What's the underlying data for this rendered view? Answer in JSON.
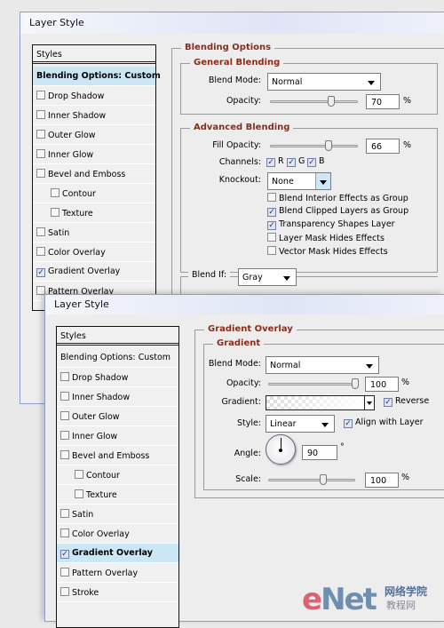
{
  "back": {
    "title": "Layer Style",
    "styles_header": "Styles",
    "styles": [
      {
        "label": "Blending Options: Custom",
        "selected": true,
        "nocheck": true
      },
      {
        "label": "Drop Shadow",
        "checked": false
      },
      {
        "label": "Inner Shadow",
        "checked": false
      },
      {
        "label": "Outer Glow",
        "checked": false
      },
      {
        "label": "Inner Glow",
        "checked": false
      },
      {
        "label": "Bevel and Emboss",
        "checked": false
      },
      {
        "label": "Contour",
        "checked": false,
        "indent": true
      },
      {
        "label": "Texture",
        "checked": false,
        "indent": true
      },
      {
        "label": "Satin",
        "checked": false
      },
      {
        "label": "Color Overlay",
        "checked": false
      },
      {
        "label": "Gradient Overlay",
        "checked": true
      },
      {
        "label": "Pattern Overlay",
        "checked": false
      }
    ],
    "section": "Blending Options",
    "general": {
      "title": "General Blending",
      "blend_mode_label": "Blend Mode:",
      "blend_mode": "Normal",
      "opacity_label": "Opacity:",
      "opacity": "70",
      "unit": "%"
    },
    "advanced": {
      "title": "Advanced Blending",
      "fill_label": "Fill Opacity:",
      "fill": "66",
      "unit": "%",
      "channels_label": "Channels:",
      "channels": [
        {
          "label": "R",
          "checked": true
        },
        {
          "label": "G",
          "checked": true
        },
        {
          "label": "B",
          "checked": true
        }
      ],
      "knockout_label": "Knockout:",
      "knockout": "None",
      "options": [
        {
          "label": "Blend Interior Effects as Group",
          "checked": false
        },
        {
          "label": "Blend Clipped Layers as Group",
          "checked": true
        },
        {
          "label": "Transparency Shapes Layer",
          "checked": true
        },
        {
          "label": "Layer Mask Hides Effects",
          "checked": false
        },
        {
          "label": "Vector Mask Hides Effects",
          "checked": false
        }
      ]
    },
    "blend_if_label": "Blend If:",
    "blend_if": "Gray"
  },
  "front": {
    "title": "Layer Style",
    "styles_header": "Styles",
    "styles": [
      {
        "label": "Blending Options: Custom",
        "nocheck": true
      },
      {
        "label": "Drop Shadow",
        "checked": false
      },
      {
        "label": "Inner Shadow",
        "checked": false
      },
      {
        "label": "Outer Glow",
        "checked": false
      },
      {
        "label": "Inner Glow",
        "checked": false
      },
      {
        "label": "Bevel and Emboss",
        "checked": false
      },
      {
        "label": "Contour",
        "checked": false,
        "indent": true
      },
      {
        "label": "Texture",
        "checked": false,
        "indent": true
      },
      {
        "label": "Satin",
        "checked": false
      },
      {
        "label": "Color Overlay",
        "checked": false
      },
      {
        "label": "Gradient Overlay",
        "checked": true,
        "selected": true
      },
      {
        "label": "Pattern Overlay",
        "checked": false
      },
      {
        "label": "Stroke",
        "checked": false
      }
    ],
    "section": "Gradient Overlay",
    "gradient": {
      "title": "Gradient",
      "blend_mode_label": "Blend Mode:",
      "blend_mode": "Normal",
      "opacity_label": "Opacity:",
      "opacity": "100",
      "unit": "%",
      "gradient_label": "Gradient:",
      "reverse_label": "Reverse",
      "reverse": true,
      "style_label": "Style:",
      "style": "Linear",
      "align_label": "Align with Layer",
      "align": true,
      "angle_label": "Angle:",
      "angle": "90",
      "degree": "°",
      "scale_label": "Scale:",
      "scale": "100"
    }
  },
  "watermark": {
    "logo": "eNet",
    "cn1": "网络学院",
    "cn2": "教程网"
  }
}
